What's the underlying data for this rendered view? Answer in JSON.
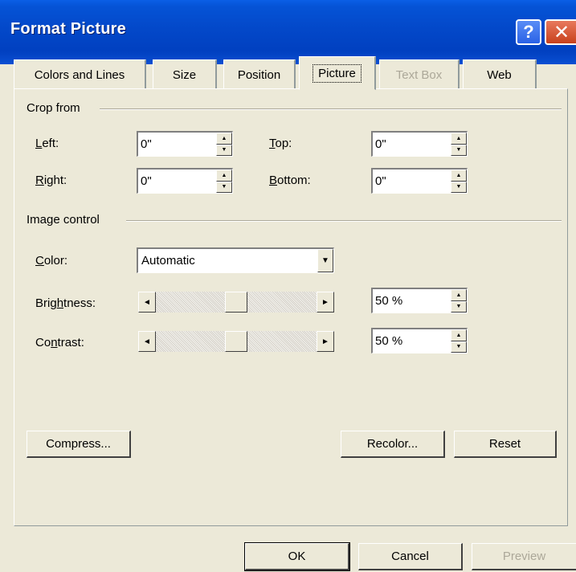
{
  "window": {
    "title": "Format Picture"
  },
  "titlebar_buttons": {
    "help": "?",
    "close": "✕"
  },
  "tabs": [
    {
      "label": "Colors and Lines",
      "state": "normal"
    },
    {
      "label": "Size",
      "state": "normal"
    },
    {
      "label": "Position",
      "state": "normal"
    },
    {
      "label": "Picture",
      "state": "active"
    },
    {
      "label": "Text Box",
      "state": "disabled"
    },
    {
      "label": "Web",
      "state": "normal"
    }
  ],
  "crop": {
    "heading": "Crop from",
    "left_label": "Left:",
    "left_value": "0\"",
    "right_label": "Right:",
    "right_value": "0\"",
    "top_label": "Top:",
    "top_value": "0\"",
    "bottom_label": "Bottom:",
    "bottom_value": "0\""
  },
  "image_control": {
    "heading": "Image control",
    "color_label": "Color:",
    "color_value": "Automatic",
    "brightness_label": "Brightness:",
    "brightness_value": "50 %",
    "brightness_level": 0.5,
    "contrast_label": "Contrast:",
    "contrast_value": "50 %",
    "contrast_level": 0.5
  },
  "buttons": {
    "compress": "Compress...",
    "recolor": "Recolor...",
    "reset": "Reset",
    "ok": "OK",
    "cancel": "Cancel",
    "preview": "Preview"
  },
  "icons": {
    "spin_up": "▲",
    "spin_down": "▼",
    "dropdown": "▼",
    "scroll_left": "◄",
    "scroll_right": "►"
  },
  "colors": {
    "titlebar": "#0348c9",
    "dialog_bg": "#ece9d8",
    "close_button": "#c8411c",
    "disabled_text": "#aca899"
  }
}
